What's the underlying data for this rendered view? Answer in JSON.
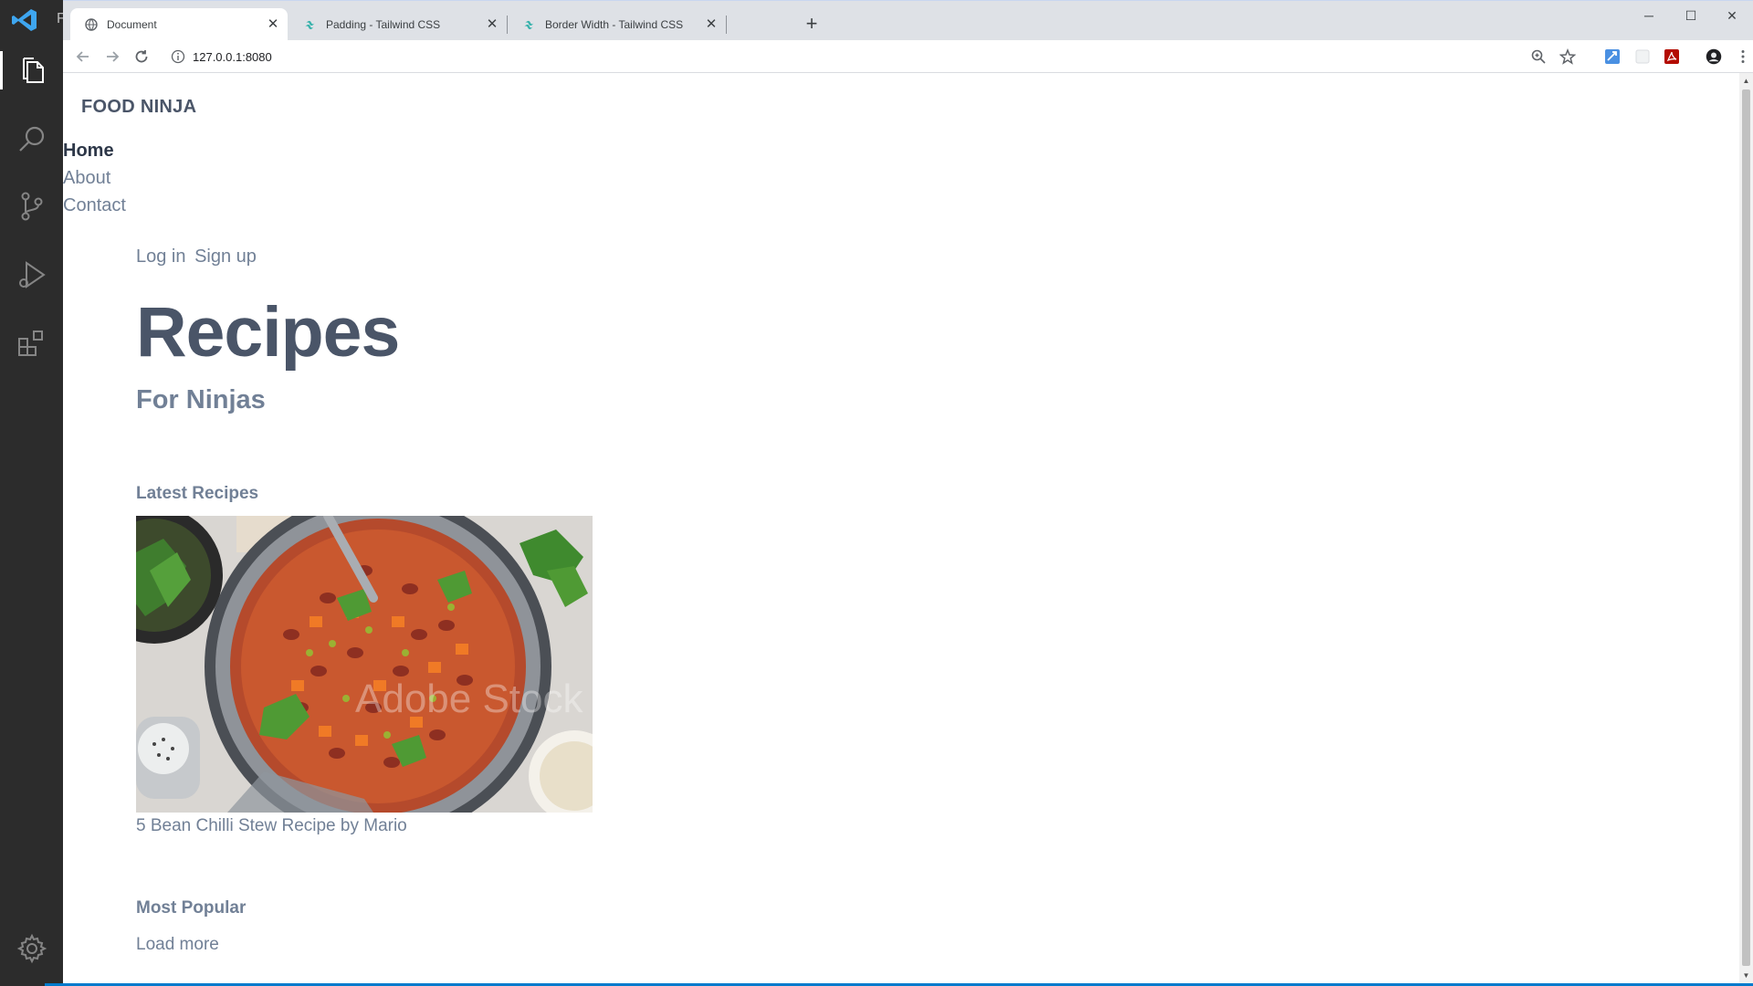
{
  "editor": {
    "title_letter": "F"
  },
  "browser": {
    "tabs": [
      {
        "title": "Document",
        "icon": "globe-icon",
        "active": true
      },
      {
        "title": "Padding - Tailwind CSS",
        "icon": "tailwind-icon",
        "active": false
      },
      {
        "title": "Border Width - Tailwind CSS",
        "icon": "tailwind-icon",
        "active": false
      }
    ],
    "new_tab": "+",
    "address": "127.0.0.1:8080",
    "window_controls": {
      "minimize": "─",
      "maximize": "☐",
      "close": "✕"
    }
  },
  "site": {
    "brand": "FOOD NINJA",
    "nav": [
      {
        "label": "Home",
        "current": true
      },
      {
        "label": "About",
        "current": false
      },
      {
        "label": "Contact",
        "current": false
      }
    ],
    "auth": {
      "login": "Log in",
      "signup": "Sign up"
    },
    "hero": {
      "title": "Recipes",
      "subtitle": "For Ninjas"
    },
    "latest": {
      "heading": "Latest Recipes",
      "card": {
        "caption": "5 Bean Chilli Stew Recipe by Mario",
        "watermark": "Adobe Stock"
      }
    },
    "popular": {
      "heading": "Most Popular"
    },
    "load_more": "Load more"
  },
  "colors": {
    "activity_bar": "#2c2c2c",
    "tab_strip": "#dee1e6",
    "text_dark": "#2d3748",
    "text_gray": "#718096",
    "heading": "#4a5568",
    "vscode_blue": "#007acc"
  }
}
